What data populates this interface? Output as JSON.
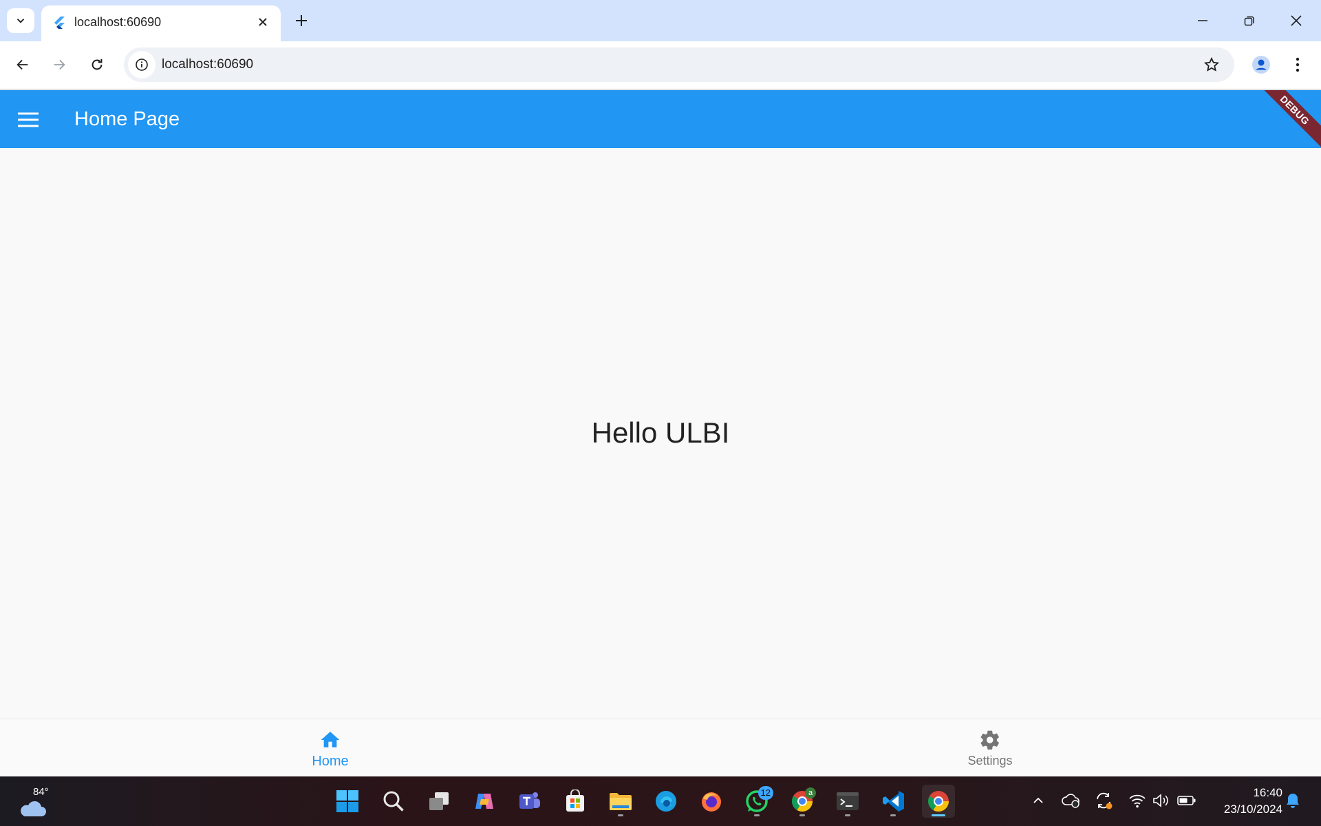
{
  "browser": {
    "tab_title": "localhost:60690",
    "url": "localhost:60690"
  },
  "app": {
    "title": "Home Page",
    "debug_banner": "DEBUG",
    "body_text": "Hello ULBI"
  },
  "bottom_nav": {
    "items": [
      {
        "label": "Home",
        "icon": "home-icon",
        "active": true
      },
      {
        "label": "Settings",
        "icon": "gear-icon",
        "active": false
      }
    ]
  },
  "taskbar": {
    "weather_temp": "84°",
    "whatsapp_badge": "12",
    "chrome_profile_badge": "a",
    "time": "16:40",
    "date": "23/10/2024"
  },
  "colors": {
    "app_bar": "#2196f3",
    "active_nav": "#2196f3",
    "inactive_nav": "#757575",
    "debug_ribbon": "#7a2732"
  }
}
